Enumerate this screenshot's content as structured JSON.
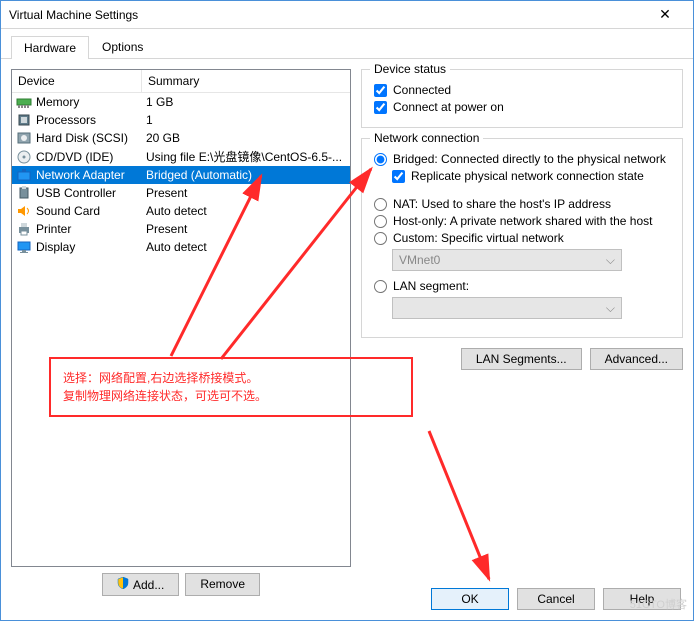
{
  "window": {
    "title": "Virtual Machine Settings"
  },
  "tabs": {
    "hardware": "Hardware",
    "options": "Options"
  },
  "headers": {
    "device": "Device",
    "summary": "Summary"
  },
  "devices": [
    {
      "icon": "memory",
      "name": "Memory",
      "summary": "1 GB"
    },
    {
      "icon": "cpu",
      "name": "Processors",
      "summary": "1"
    },
    {
      "icon": "hdd",
      "name": "Hard Disk (SCSI)",
      "summary": "20 GB"
    },
    {
      "icon": "cd",
      "name": "CD/DVD (IDE)",
      "summary": "Using file E:\\光盘镜像\\CentOS-6.5-..."
    },
    {
      "icon": "net",
      "name": "Network Adapter",
      "summary": "Bridged (Automatic)"
    },
    {
      "icon": "usb",
      "name": "USB Controller",
      "summary": "Present"
    },
    {
      "icon": "sound",
      "name": "Sound Card",
      "summary": "Auto detect"
    },
    {
      "icon": "printer",
      "name": "Printer",
      "summary": "Present"
    },
    {
      "icon": "display",
      "name": "Display",
      "summary": "Auto detect"
    }
  ],
  "selectedDevice": 4,
  "buttons": {
    "add": "Add...",
    "remove": "Remove",
    "lanSegments": "LAN Segments...",
    "advanced": "Advanced...",
    "ok": "OK",
    "cancel": "Cancel",
    "help": "Help"
  },
  "deviceStatus": {
    "title": "Device status",
    "connected": "Connected",
    "connectAtPowerOn": "Connect at power on",
    "connectedChecked": true,
    "connectAtPowerOnChecked": true
  },
  "network": {
    "title": "Network connection",
    "bridged": "Bridged: Connected directly to the physical network",
    "replicate": "Replicate physical network connection state",
    "nat": "NAT: Used to share the host's IP address",
    "hostOnly": "Host-only: A private network shared with the host",
    "custom": "Custom: Specific virtual network",
    "customValue": "VMnet0",
    "lanSegment": "LAN segment:",
    "lanSegmentValue": "",
    "selected": "bridged",
    "replicateChecked": true
  },
  "annotation": {
    "line1": "选择：网络配置,右边选择桥接模式。",
    "line2": "复制物理网络连接状态，可选可不选。"
  },
  "watermark": "51CTO博客"
}
